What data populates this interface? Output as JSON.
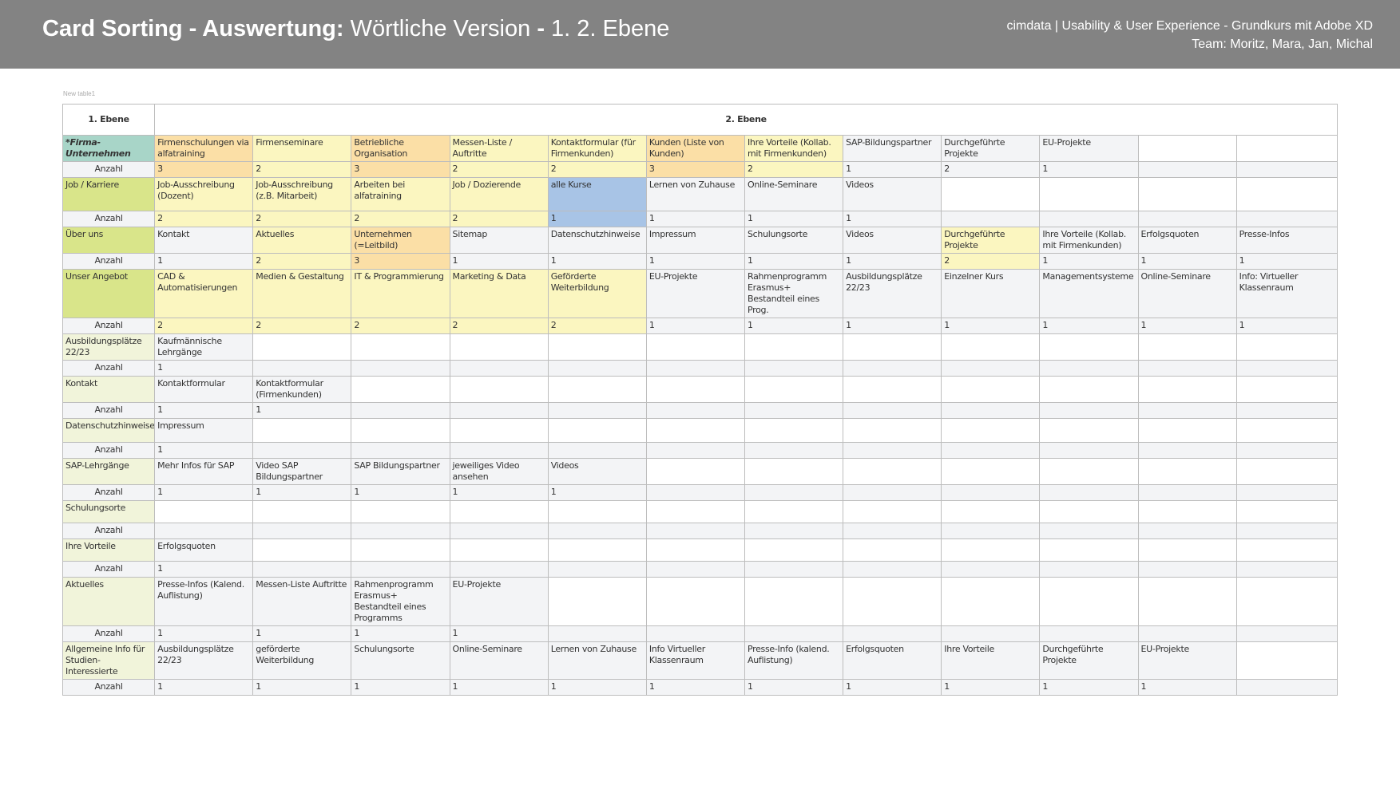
{
  "header": {
    "title_bold": "Card Sorting - Auswertung:",
    "title_rest": "Wörtliche Version",
    "title_bold2": "-",
    "title_rest2": "1. 2. Ebene",
    "meta_line1": "cimdata | Usability & User Experience - Grundkurs mit Adobe XD",
    "meta_line2": "Team: Moritz, Mara, Jan, Michal"
  },
  "table_caption": "New table1",
  "column_headers": {
    "level1": "1. Ebene",
    "level2": "2. Ebene"
  },
  "count_label": "Anzahl",
  "colors": {
    "header_bg": "#838383",
    "teal": "#a8d5c8",
    "lime": "#d9e58a",
    "lime_light": "#f1f4da",
    "orange": "#fbdfa6",
    "yellow": "#fbf6c0",
    "blue": "#a8c4e6",
    "gray": "#f3f4f6"
  },
  "groups": [
    {
      "label": "*Firma-Unternehmen",
      "label_color": "teal",
      "items": [
        {
          "text": "Firmenschulungen via alfatraining",
          "count": "3",
          "color": "orange"
        },
        {
          "text": "Firmenseminare",
          "count": "2",
          "color": "yellow"
        },
        {
          "text": "Betriebliche Organisation",
          "count": "3",
          "color": "orange"
        },
        {
          "text": "Messen-Liste / Auftritte",
          "count": "2",
          "color": "yellow"
        },
        {
          "text": "Kontaktformular (für Firmenkunden)",
          "count": "2",
          "color": "yellow"
        },
        {
          "text": "Kunden (Liste von Kunden)",
          "count": "3",
          "color": "orange"
        },
        {
          "text": "Ihre Vorteile (Kollab. mit Firmenkunden)",
          "count": "2",
          "color": "yellow"
        },
        {
          "text": "SAP-Bildungspartner",
          "count": "1",
          "color": "gray"
        },
        {
          "text": "Durchgeführte Projekte",
          "count": "2",
          "color": "gray"
        },
        {
          "text": "EU-Projekte",
          "count": "1",
          "color": "gray"
        },
        {
          "text": "",
          "count": "",
          "color": "white"
        },
        {
          "text": "",
          "count": "",
          "color": "white"
        }
      ]
    },
    {
      "label": "Job / Karriere",
      "label_color": "lime",
      "items": [
        {
          "text": "Job-Ausschreibung (Dozent)",
          "count": "2",
          "color": "yellow"
        },
        {
          "text": "Job-Ausschreibung (z.B. Mitarbeit)",
          "count": "2",
          "color": "yellow"
        },
        {
          "text": "Arbeiten bei alfatraining",
          "count": "2",
          "color": "yellow"
        },
        {
          "text": "Job / Dozierende",
          "count": "2",
          "color": "yellow"
        },
        {
          "text": "alle Kurse",
          "count": "1",
          "color": "blue"
        },
        {
          "text": "Lernen von Zuhause",
          "count": "1",
          "color": "gray"
        },
        {
          "text": "Online-Seminare",
          "count": "1",
          "color": "gray"
        },
        {
          "text": "Videos",
          "count": "1",
          "color": "gray"
        },
        {
          "text": "",
          "count": "",
          "color": "white"
        },
        {
          "text": "",
          "count": "",
          "color": "white"
        },
        {
          "text": "",
          "count": "",
          "color": "white"
        },
        {
          "text": "",
          "count": "",
          "color": "white"
        }
      ]
    },
    {
      "label": "Über uns",
      "label_color": "lime",
      "items": [
        {
          "text": "Kontakt",
          "count": "1",
          "color": "gray"
        },
        {
          "text": "Aktuelles",
          "count": "2",
          "color": "yellow"
        },
        {
          "text": "Unternehmen (=Leitbild)",
          "count": "3",
          "color": "orange"
        },
        {
          "text": "Sitemap",
          "count": "1",
          "color": "gray"
        },
        {
          "text": "Datenschutzhinweise",
          "count": "1",
          "color": "gray"
        },
        {
          "text": "Impressum",
          "count": "1",
          "color": "gray"
        },
        {
          "text": "Schulungsorte",
          "count": "1",
          "color": "gray"
        },
        {
          "text": "Videos",
          "count": "1",
          "color": "gray"
        },
        {
          "text": "Durchgeführte Projekte",
          "count": "2",
          "color": "yellow"
        },
        {
          "text": "Ihre Vorteile (Kollab. mit Firmenkunden)",
          "count": "1",
          "color": "gray"
        },
        {
          "text": "Erfolgsquoten",
          "count": "1",
          "color": "gray"
        },
        {
          "text": "Presse-Infos",
          "count": "1",
          "color": "gray"
        }
      ]
    },
    {
      "label": "Unser Angebot",
      "label_color": "lime",
      "items": [
        {
          "text": "CAD & Automatisierungen",
          "count": "2",
          "color": "yellow"
        },
        {
          "text": "Medien & Gestaltung",
          "count": "2",
          "color": "yellow"
        },
        {
          "text": "IT & Programmierung",
          "count": "2",
          "color": "yellow"
        },
        {
          "text": "Marketing & Data",
          "count": "2",
          "color": "yellow"
        },
        {
          "text": "Geförderte Weiterbildung",
          "count": "2",
          "color": "yellow"
        },
        {
          "text": "EU-Projekte",
          "count": "1",
          "color": "gray"
        },
        {
          "text": "Rahmenprogramm Erasmus+ Bestandteil eines Prog.",
          "count": "1",
          "color": "gray"
        },
        {
          "text": "Ausbildungsplätze 22/23",
          "count": "1",
          "color": "gray"
        },
        {
          "text": "Einzelner Kurs",
          "count": "1",
          "color": "gray"
        },
        {
          "text": "Managementsysteme",
          "count": "1",
          "color": "gray"
        },
        {
          "text": "Online-Seminare",
          "count": "1",
          "color": "gray"
        },
        {
          "text": "Info: Virtueller Klassenraum",
          "count": "1",
          "color": "gray"
        }
      ]
    },
    {
      "label": "Ausbildungsplätze 22/23",
      "label_color": "lime_light",
      "items": [
        {
          "text": "Kaufmännische Lehrgänge",
          "count": "1",
          "color": "gray"
        },
        {
          "text": "",
          "count": "",
          "color": "white"
        },
        {
          "text": "",
          "count": "",
          "color": "white"
        },
        {
          "text": "",
          "count": "",
          "color": "white"
        },
        {
          "text": "",
          "count": "",
          "color": "white"
        },
        {
          "text": "",
          "count": "",
          "color": "white"
        },
        {
          "text": "",
          "count": "",
          "color": "white"
        },
        {
          "text": "",
          "count": "",
          "color": "white"
        },
        {
          "text": "",
          "count": "",
          "color": "white"
        },
        {
          "text": "",
          "count": "",
          "color": "white"
        },
        {
          "text": "",
          "count": "",
          "color": "white"
        },
        {
          "text": "",
          "count": "",
          "color": "white"
        }
      ]
    },
    {
      "label": "Kontakt",
      "label_color": "lime_light",
      "items": [
        {
          "text": "Kontaktformular",
          "count": "1",
          "color": "gray"
        },
        {
          "text": "Kontaktformular (Firmenkunden)",
          "count": "1",
          "color": "gray"
        },
        {
          "text": "",
          "count": "",
          "color": "white"
        },
        {
          "text": "",
          "count": "",
          "color": "white"
        },
        {
          "text": "",
          "count": "",
          "color": "white"
        },
        {
          "text": "",
          "count": "",
          "color": "white"
        },
        {
          "text": "",
          "count": "",
          "color": "white"
        },
        {
          "text": "",
          "count": "",
          "color": "white"
        },
        {
          "text": "",
          "count": "",
          "color": "white"
        },
        {
          "text": "",
          "count": "",
          "color": "white"
        },
        {
          "text": "",
          "count": "",
          "color": "white"
        },
        {
          "text": "",
          "count": "",
          "color": "white"
        }
      ]
    },
    {
      "label": "Datenschutzhinweise",
      "label_color": "lime_light",
      "items": [
        {
          "text": "Impressum",
          "count": "1",
          "color": "gray"
        },
        {
          "text": "",
          "count": "",
          "color": "white"
        },
        {
          "text": "",
          "count": "",
          "color": "white"
        },
        {
          "text": "",
          "count": "",
          "color": "white"
        },
        {
          "text": "",
          "count": "",
          "color": "white"
        },
        {
          "text": "",
          "count": "",
          "color": "white"
        },
        {
          "text": "",
          "count": "",
          "color": "white"
        },
        {
          "text": "",
          "count": "",
          "color": "white"
        },
        {
          "text": "",
          "count": "",
          "color": "white"
        },
        {
          "text": "",
          "count": "",
          "color": "white"
        },
        {
          "text": "",
          "count": "",
          "color": "white"
        },
        {
          "text": "",
          "count": "",
          "color": "white"
        }
      ]
    },
    {
      "label": "SAP-Lehrgänge",
      "label_color": "lime_light",
      "items": [
        {
          "text": "Mehr Infos für SAP",
          "count": "1",
          "color": "gray"
        },
        {
          "text": "Video SAP Bildungspartner",
          "count": "1",
          "color": "gray"
        },
        {
          "text": "SAP Bildungspartner",
          "count": "1",
          "color": "gray"
        },
        {
          "text": "jeweiliges Video ansehen",
          "count": "1",
          "color": "gray"
        },
        {
          "text": "Videos",
          "count": "1",
          "color": "gray"
        },
        {
          "text": "",
          "count": "",
          "color": "white"
        },
        {
          "text": "",
          "count": "",
          "color": "white"
        },
        {
          "text": "",
          "count": "",
          "color": "white"
        },
        {
          "text": "",
          "count": "",
          "color": "white"
        },
        {
          "text": "",
          "count": "",
          "color": "white"
        },
        {
          "text": "",
          "count": "",
          "color": "white"
        },
        {
          "text": "",
          "count": "",
          "color": "white"
        }
      ]
    },
    {
      "label": "Schulungsorte",
      "label_color": "lime_light",
      "items": [
        {
          "text": "",
          "count": "",
          "color": "white"
        },
        {
          "text": "",
          "count": "",
          "color": "white"
        },
        {
          "text": "",
          "count": "",
          "color": "white"
        },
        {
          "text": "",
          "count": "",
          "color": "white"
        },
        {
          "text": "",
          "count": "",
          "color": "white"
        },
        {
          "text": "",
          "count": "",
          "color": "white"
        },
        {
          "text": "",
          "count": "",
          "color": "white"
        },
        {
          "text": "",
          "count": "",
          "color": "white"
        },
        {
          "text": "",
          "count": "",
          "color": "white"
        },
        {
          "text": "",
          "count": "",
          "color": "white"
        },
        {
          "text": "",
          "count": "",
          "color": "white"
        },
        {
          "text": "",
          "count": "",
          "color": "white"
        }
      ]
    },
    {
      "label": "Ihre Vorteile",
      "label_color": "lime_light",
      "items": [
        {
          "text": "Erfolgsquoten",
          "count": "1",
          "color": "gray"
        },
        {
          "text": "",
          "count": "",
          "color": "white"
        },
        {
          "text": "",
          "count": "",
          "color": "white"
        },
        {
          "text": "",
          "count": "",
          "color": "white"
        },
        {
          "text": "",
          "count": "",
          "color": "white"
        },
        {
          "text": "",
          "count": "",
          "color": "white"
        },
        {
          "text": "",
          "count": "",
          "color": "white"
        },
        {
          "text": "",
          "count": "",
          "color": "white"
        },
        {
          "text": "",
          "count": "",
          "color": "white"
        },
        {
          "text": "",
          "count": "",
          "color": "white"
        },
        {
          "text": "",
          "count": "",
          "color": "white"
        },
        {
          "text": "",
          "count": "",
          "color": "white"
        }
      ]
    },
    {
      "label": "Aktuelles",
      "label_color": "lime_light",
      "items": [
        {
          "text": "Presse-Infos (Kalend. Auflistung)",
          "count": "1",
          "color": "gray"
        },
        {
          "text": "Messen-Liste Auftritte",
          "count": "1",
          "color": "gray"
        },
        {
          "text": "Rahmenprogramm Erasmus+ Bestandteil eines Programms",
          "count": "1",
          "color": "gray"
        },
        {
          "text": "EU-Projekte",
          "count": "1",
          "color": "gray"
        },
        {
          "text": "",
          "count": "",
          "color": "white"
        },
        {
          "text": "",
          "count": "",
          "color": "white"
        },
        {
          "text": "",
          "count": "",
          "color": "white"
        },
        {
          "text": "",
          "count": "",
          "color": "white"
        },
        {
          "text": "",
          "count": "",
          "color": "white"
        },
        {
          "text": "",
          "count": "",
          "color": "white"
        },
        {
          "text": "",
          "count": "",
          "color": "white"
        },
        {
          "text": "",
          "count": "",
          "color": "white"
        }
      ]
    },
    {
      "label": "Allgemeine Info für Studien-Interessierte",
      "label_color": "lime_light",
      "items": [
        {
          "text": "Ausbildungsplätze 22/23",
          "count": "1",
          "color": "gray"
        },
        {
          "text": "geförderte Weiterbildung",
          "count": "1",
          "color": "gray"
        },
        {
          "text": "Schulungsorte",
          "count": "1",
          "color": "gray"
        },
        {
          "text": "Online-Seminare",
          "count": "1",
          "color": "gray"
        },
        {
          "text": "Lernen von Zuhause",
          "count": "1",
          "color": "gray"
        },
        {
          "text": "Info Virtueller Klassenraum",
          "count": "1",
          "color": "gray"
        },
        {
          "text": "Presse-Info (kalend. Auflistung)",
          "count": "1",
          "color": "gray"
        },
        {
          "text": "Erfolgsquoten",
          "count": "1",
          "color": "gray"
        },
        {
          "text": "Ihre Vorteile",
          "count": "1",
          "color": "gray"
        },
        {
          "text": "Durchgeführte Projekte",
          "count": "1",
          "color": "gray"
        },
        {
          "text": "EU-Projekte",
          "count": "1",
          "color": "gray"
        },
        {
          "text": "",
          "count": "",
          "color": "white"
        }
      ]
    }
  ]
}
